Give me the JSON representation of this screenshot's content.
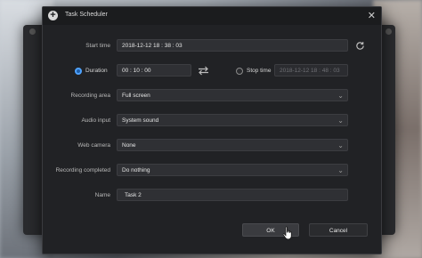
{
  "dialog": {
    "title": "Task Scheduler",
    "close_symbol": "✕",
    "title_icon_symbol": "+"
  },
  "form": {
    "start_time": {
      "label": "Start time",
      "value": "2018-12-12 18 : 38 : 03"
    },
    "duration": {
      "label": "Duration",
      "value": "00 : 10 : 00",
      "selected": true
    },
    "stop_time": {
      "label": "Stop time",
      "value": "2018-12-12 18 : 48 : 03",
      "selected": false
    },
    "recording_area": {
      "label": "Recording area",
      "value": "Full screen"
    },
    "audio_input": {
      "label": "Audio input",
      "value": "System sound"
    },
    "web_camera": {
      "label": "Web camera",
      "value": "None"
    },
    "recording_completed": {
      "label": "Recording completed",
      "value": "Do nothing"
    },
    "name": {
      "label": "Name",
      "value": "Task 2"
    }
  },
  "buttons": {
    "ok": "OK",
    "cancel": "Cancel"
  },
  "icons": {
    "refresh": "refresh-icon",
    "swap": "swap-icon",
    "dropdown": "chevron-down-icon"
  },
  "colors": {
    "accent": "#4fa3ff",
    "dialog_bg": "#212225"
  }
}
